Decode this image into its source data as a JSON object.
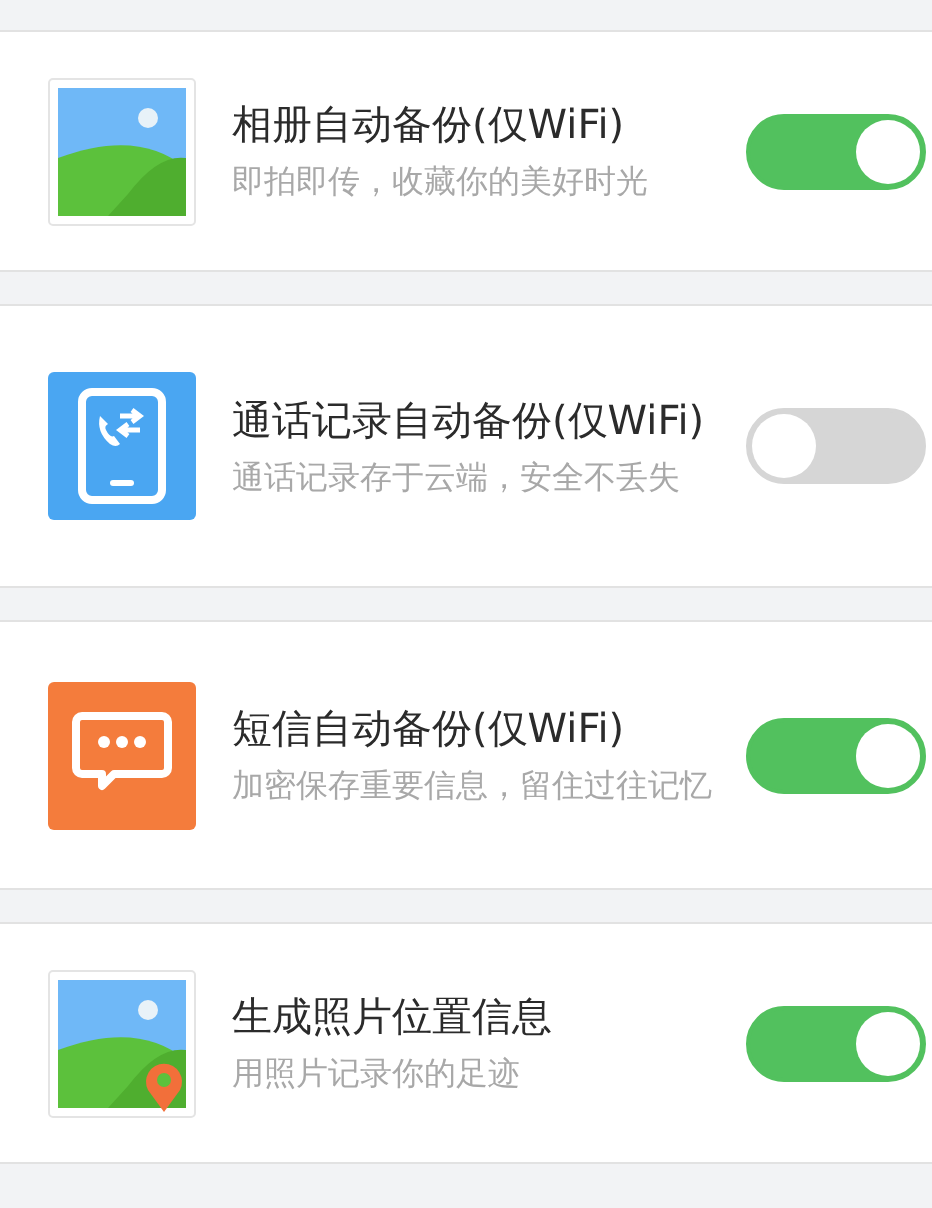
{
  "settings": [
    {
      "kind": "photo",
      "title": "相册自动备份(仅WiFi)",
      "subtitle": "即拍即传，收藏你的美好时光",
      "on": true
    },
    {
      "kind": "calls",
      "title": "通话记录自动备份(仅WiFi)",
      "subtitle": "通话记录存于云端，安全不丢失",
      "on": false
    },
    {
      "kind": "sms",
      "title": "短信自动备份(仅WiFi)",
      "subtitle": "加密保存重要信息，留住过往记忆",
      "on": true
    },
    {
      "kind": "location",
      "title": "生成照片位置信息",
      "subtitle": "用照片记录你的足迹",
      "on": true
    }
  ]
}
